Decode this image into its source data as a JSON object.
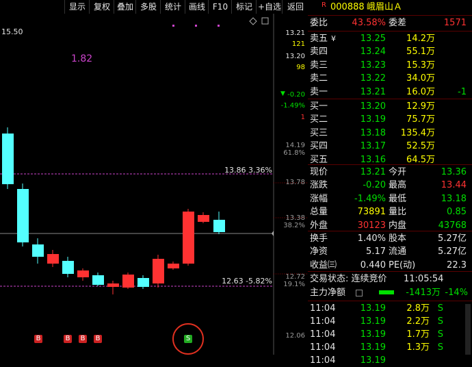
{
  "toolbar": [
    "显示",
    "复权",
    "叠加",
    "多股",
    "统计",
    "画线",
    "F10",
    "标记",
    "+自选",
    "返回"
  ],
  "chart": {
    "price_high_label": "15.50",
    "indicator_value": "1.82",
    "right_axis": [
      {
        "v": "13.21",
        "c": "#e6e6e6"
      },
      {
        "v": "121",
        "c": "#ffff00"
      },
      {
        "v": "13.20",
        "c": "#e6e6e6"
      },
      {
        "v": "98",
        "c": "#ffff00"
      },
      {
        "v": "-0.20",
        "c": "#00e000"
      },
      {
        "v": "-1.49%",
        "c": "#00e000"
      },
      {
        "v": "1",
        "c": "#ff3232"
      },
      {
        "v": "14.19",
        "c": "#9a9a9a"
      },
      {
        "v": "61.8%",
        "c": "#9a9a9a"
      },
      {
        "v": "13.78",
        "c": "#9a9a9a"
      },
      {
        "v": "13.38",
        "c": "#9a9a9a"
      },
      {
        "v": "38.2%",
        "c": "#9a9a9a"
      },
      {
        "v": "12.72",
        "c": "#9a9a9a"
      },
      {
        "v": "19.1%",
        "c": "#9a9a9a"
      },
      {
        "v": "12.06",
        "c": "#9a9a9a"
      }
    ],
    "line_high_label": "13.86  3.36%",
    "line_low_label": "12.63  -5.82%",
    "buy_marker": "B",
    "sell_marker": "S"
  },
  "stock": {
    "badge": "R",
    "code": "000888",
    "name": "峨眉山Ａ"
  },
  "order": {
    "webi_label": "委比",
    "webi_value": "43.58%",
    "wecha_label": "委差",
    "wecha_value": "1571",
    "asks": [
      {
        "label": "卖五",
        "price": "13.25",
        "vol": "14.2万",
        "extra": ""
      },
      {
        "label": "卖四",
        "price": "13.24",
        "vol": "55.1万",
        "extra": ""
      },
      {
        "label": "卖三",
        "price": "13.23",
        "vol": "15.3万",
        "extra": ""
      },
      {
        "label": "卖二",
        "price": "13.22",
        "vol": "34.0万",
        "extra": ""
      },
      {
        "label": "卖一",
        "price": "13.21",
        "vol": "16.0万",
        "extra": "-1"
      }
    ],
    "bids": [
      {
        "label": "买一",
        "price": "13.20",
        "vol": "12.9万"
      },
      {
        "label": "买二",
        "price": "13.19",
        "vol": "75.7万"
      },
      {
        "label": "买三",
        "price": "13.18",
        "vol": "135.4万"
      },
      {
        "label": "买四",
        "price": "13.17",
        "vol": "52.5万"
      },
      {
        "label": "买五",
        "price": "13.16",
        "vol": "64.5万"
      }
    ]
  },
  "quote": {
    "rows": [
      {
        "l1": "现价",
        "v1": "13.21",
        "c1": "g",
        "l2": "今开",
        "v2": "13.36",
        "c2": "g"
      },
      {
        "l1": "涨跌",
        "v1": "-0.20",
        "c1": "g",
        "l2": "最高",
        "v2": "13.44",
        "c2": "r"
      },
      {
        "l1": "涨幅",
        "v1": "-1.49%",
        "c1": "g",
        "l2": "最低",
        "v2": "13.18",
        "c2": "g"
      },
      {
        "l1": "总量",
        "v1": "73891",
        "c1": "y",
        "l2": "量比",
        "v2": "0.85",
        "c2": "g"
      },
      {
        "l1": "外盘",
        "v1": "30123",
        "c1": "r",
        "l2": "内盘",
        "v2": "43768",
        "c2": "g"
      }
    ],
    "rows2": [
      {
        "l1": "换手",
        "v1": "1.40%",
        "l2": "股本",
        "v2": "5.27亿"
      },
      {
        "l1": "净资",
        "v1": "5.17",
        "l2": "流通",
        "v2": "5.27亿"
      },
      {
        "l1": "收益㈢",
        "v1": "0.440",
        "l2": "PE(动)",
        "v2": "22.3"
      }
    ],
    "trade_status_label": "交易状态: 连续竞价",
    "trade_time": "11:05:54",
    "main_flow_label": "主力净额",
    "main_flow_value": "-1413万",
    "main_flow_pct": "-14%"
  },
  "ticks": [
    {
      "t": "11:04",
      "p": "13.19",
      "v": "2.8万",
      "s": "S"
    },
    {
      "t": "11:04",
      "p": "13.19",
      "v": "2.2万",
      "s": "S"
    },
    {
      "t": "11:04",
      "p": "13.19",
      "v": "1.7万",
      "s": "S"
    },
    {
      "t": "11:04",
      "p": "13.19",
      "v": "1.3万",
      "s": "S"
    },
    {
      "t": "11:04",
      "p": "13.19",
      "v": "",
      "s": ""
    }
  ]
}
